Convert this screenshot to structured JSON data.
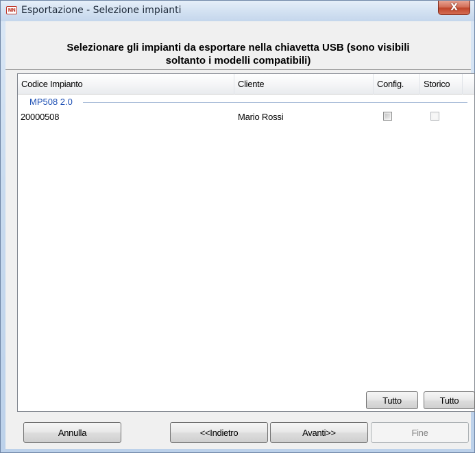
{
  "window": {
    "title": "Esportazione - Selezione impianti",
    "close_label": "X",
    "icon_text": "NN"
  },
  "header": {
    "line1": "Selezionare gli impianti da esportare nella chiavetta USB (sono visibili",
    "line2": "soltanto i modelli compatibili)"
  },
  "list": {
    "columns": [
      "Codice Impianto",
      "Cliente",
      "Config.",
      "Storico"
    ],
    "groups": [
      {
        "name": "MP508 2.0",
        "rows": [
          {
            "codice": "20000508",
            "cliente": "Mario Rossi",
            "config": false,
            "storico": false
          }
        ]
      }
    ]
  },
  "select_all": {
    "config_label": "Tutto",
    "storico_label": "Tutto"
  },
  "buttons": {
    "annulla": "Annulla",
    "indietro": "<<Indietro",
    "avanti": "Avanti>>",
    "fine": "Fine"
  },
  "colors": {
    "group_text": "#1e50b4",
    "close_button": "#c0452b"
  },
  "icons": {
    "app": "app-logo-icon",
    "close": "close-icon"
  }
}
